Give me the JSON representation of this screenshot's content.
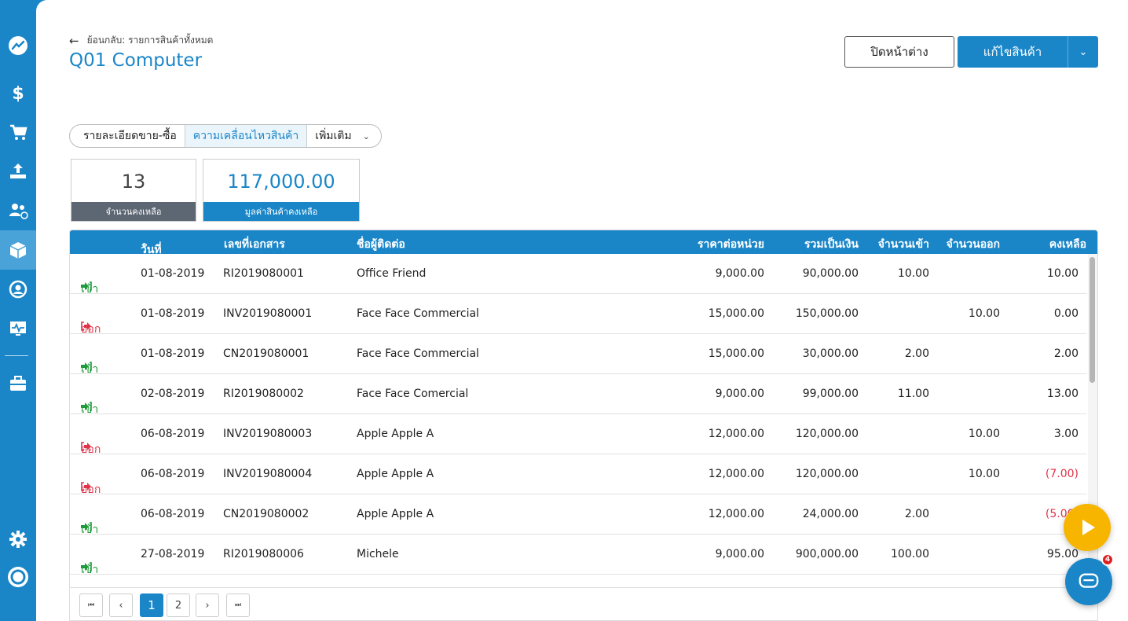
{
  "header": {
    "back_label": "ย้อนกลับ: รายการสินค้าทั้งหมด",
    "title": "Q01 Computer",
    "close_button": "ปิดหน้าต่าง",
    "edit_button": "แก้ไขสินค้า"
  },
  "tabs": [
    {
      "label": "รายละเอียดขาย-ซื้อ"
    },
    {
      "label": "ความเคลื่อนไหวสินค้า"
    },
    {
      "label": "เพิ่มเติม"
    }
  ],
  "summary": {
    "qty_value": "13",
    "qty_label": "จำนวนคงเหลือ",
    "amount_value": "117,000.00",
    "amount_label": "มูลค่าสินค้าคงเหลือ"
  },
  "table": {
    "headers": {
      "date": "วันที่",
      "sort_icon": "^",
      "doc": "เลขที่เอกสาร",
      "contact": "ชื่อผู้ติดต่อ",
      "unit_price": "ราคาต่อหน่วย",
      "total": "รวมเป็นเงิน",
      "qty_in": "จำนวนเข้า",
      "qty_out": "จำนวนออก",
      "balance": "คงเหลือ"
    },
    "rows": [
      {
        "dir": "เข้า",
        "type": "in",
        "date": "01-08-2019",
        "doc": "RI2019080001",
        "contact": "Office Friend",
        "unit_price": "9,000.00",
        "total": "90,000.00",
        "qty_in": "10.00",
        "qty_out": "",
        "balance": "10.00"
      },
      {
        "dir": "ออก",
        "type": "out",
        "date": "01-08-2019",
        "doc": "INV2019080001",
        "contact": "Face Face Commercial",
        "unit_price": "15,000.00",
        "total": "150,000.00",
        "qty_in": "",
        "qty_out": "10.00",
        "balance": "0.00"
      },
      {
        "dir": "เข้า",
        "type": "in",
        "date": "01-08-2019",
        "doc": "CN2019080001",
        "contact": "Face Face Commercial",
        "unit_price": "15,000.00",
        "total": "30,000.00",
        "qty_in": "2.00",
        "qty_out": "",
        "balance": "2.00"
      },
      {
        "dir": "เข้า",
        "type": "in",
        "date": "02-08-2019",
        "doc": "RI2019080002",
        "contact": "Face Face Comercial",
        "unit_price": "9,000.00",
        "total": "99,000.00",
        "qty_in": "11.00",
        "qty_out": "",
        "balance": "13.00"
      },
      {
        "dir": "ออก",
        "type": "out",
        "date": "06-08-2019",
        "doc": "INV2019080003",
        "contact": "Apple Apple A",
        "unit_price": "12,000.00",
        "total": "120,000.00",
        "qty_in": "",
        "qty_out": "10.00",
        "balance": "3.00"
      },
      {
        "dir": "ออก",
        "type": "out",
        "date": "06-08-2019",
        "doc": "INV2019080004",
        "contact": "Apple Apple A",
        "unit_price": "12,000.00",
        "total": "120,000.00",
        "qty_in": "",
        "qty_out": "10.00",
        "balance": "(7.00)"
      },
      {
        "dir": "เข้า",
        "type": "in",
        "date": "06-08-2019",
        "doc": "CN2019080002",
        "contact": "Apple Apple A",
        "unit_price": "12,000.00",
        "total": "24,000.00",
        "qty_in": "2.00",
        "qty_out": "",
        "balance": "(5.00)"
      },
      {
        "dir": "เข้า",
        "type": "in",
        "date": "27-08-2019",
        "doc": "RI2019080006",
        "contact": "Michele",
        "unit_price": "9,000.00",
        "total": "900,000.00",
        "qty_in": "100.00",
        "qty_out": "",
        "balance": "95.00"
      }
    ]
  },
  "pager": {
    "first": "⏮",
    "prev": "‹",
    "pages": [
      "1",
      "2"
    ],
    "next": "›",
    "last": "⏭"
  },
  "chat_badge": "4",
  "colors": {
    "accent": "#1a86c8",
    "in": "#1e9b3a",
    "out": "#e0344a",
    "fab": "#f7b500"
  }
}
